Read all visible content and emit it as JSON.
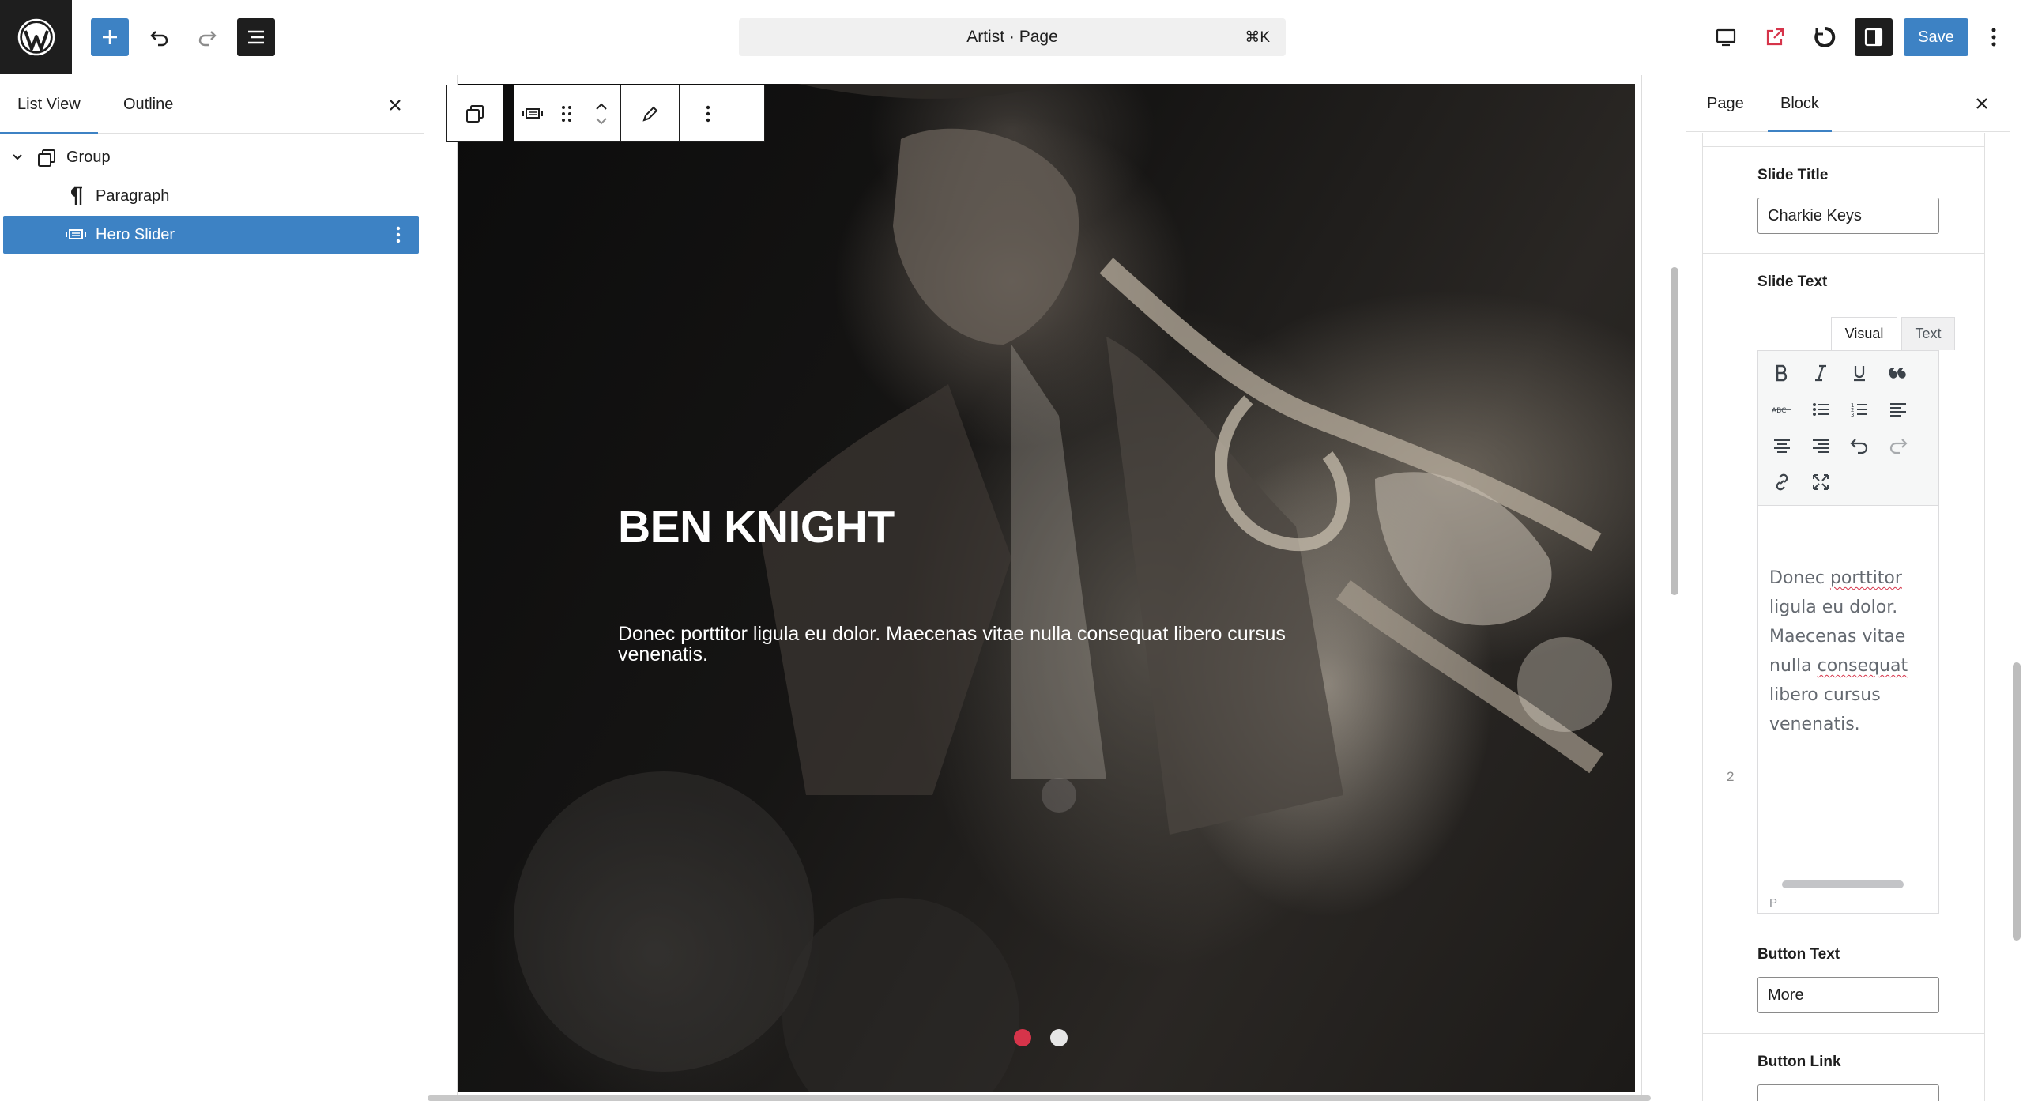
{
  "header": {
    "document_title": "Artist · Page",
    "shortcut": "⌘K",
    "save_label": "Save",
    "icons": [
      "wordpress-logo",
      "plus-icon",
      "undo-icon",
      "redo-icon",
      "list-view-icon",
      "desktop-icon",
      "external-link-icon",
      "sync-icon",
      "sidebar-icon",
      "more-vertical-icon"
    ]
  },
  "left_panel": {
    "tabs": [
      {
        "label": "List View",
        "active": true
      },
      {
        "label": "Outline",
        "active": false
      }
    ],
    "tree": [
      {
        "label": "Group",
        "icon": "group-icon",
        "expanded": true
      },
      {
        "label": "Paragraph",
        "icon": "paragraph-icon"
      },
      {
        "label": "Hero Slider",
        "icon": "slider-icon",
        "selected": true
      }
    ]
  },
  "canvas": {
    "hero": {
      "title": "BEN KNIGHT",
      "text": "Donec porttitor ligula eu dolor. Maecenas vitae nulla consequat libero cursus venenatis.",
      "slide_count": 2,
      "active_slide": 1
    },
    "colors": {
      "active_dot": "#d6344a",
      "inactive_dot": "#e6e6e6",
      "accent": "#3d82c4"
    }
  },
  "right_panel": {
    "tabs": [
      {
        "label": "Page",
        "active": false
      },
      {
        "label": "Block",
        "active": true
      }
    ],
    "slide_title_label": "Slide Title",
    "slide_title_value": "Charkie Keys",
    "slide_text_label": "Slide Text",
    "editor_tabs": {
      "visual": "Visual",
      "text": "Text"
    },
    "row_number": "2",
    "editor_content": {
      "w1": "Donec ",
      "w2": "porttitor",
      "w3": " ligula eu dolor. Maecenas vitae nulla ",
      "w4": "consequat",
      "w5": " libero cursus venenatis."
    },
    "editor_status": "P",
    "button_text_label": "Button Text",
    "button_text_value": "More",
    "button_link_label": "Button Link",
    "button_link_value": ""
  }
}
